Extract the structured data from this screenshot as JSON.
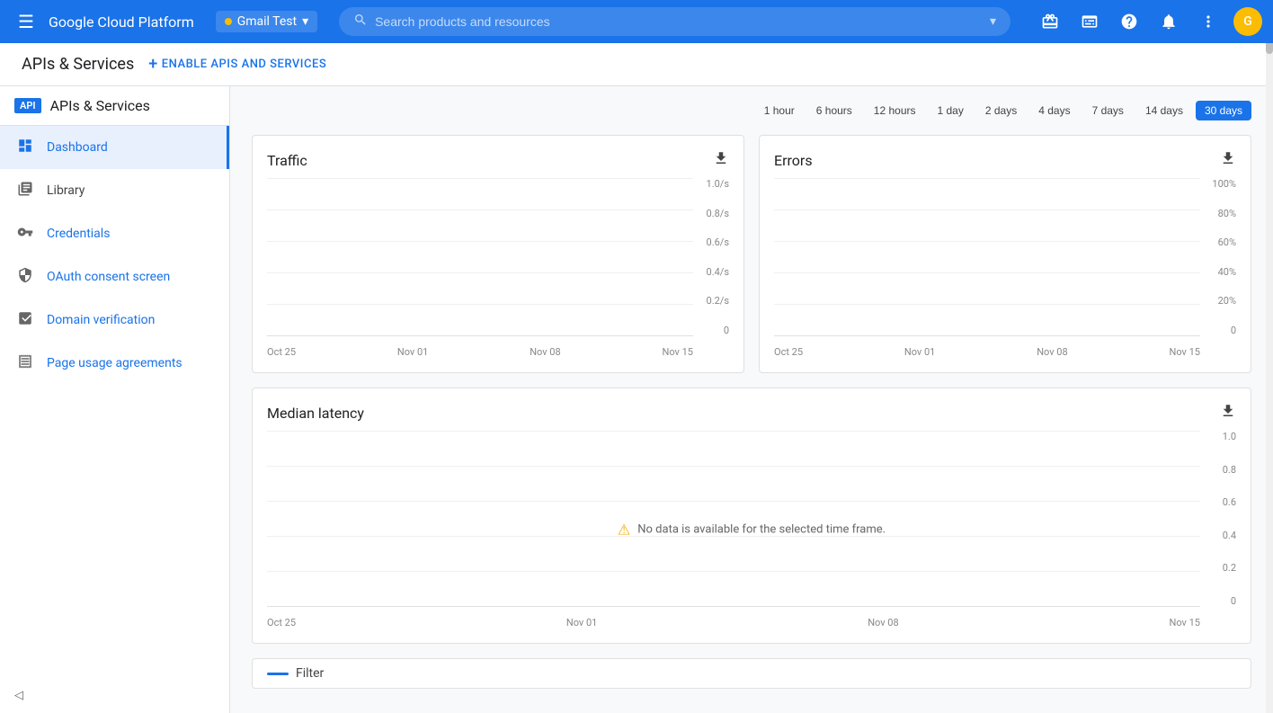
{
  "topNav": {
    "hamburger_icon": "☰",
    "brand": "Google Cloud Platform",
    "project_name": "Gmail Test",
    "project_chevron": "▾",
    "search_placeholder": "Search products and resources",
    "search_chevron": "▾",
    "gift_icon": "🎁",
    "terminal_icon": "▦",
    "help_icon": "?",
    "notification_icon": "🔔",
    "more_icon": "⋮",
    "avatar_text": "G"
  },
  "subHeader": {
    "page_title": "APIs & Services",
    "enable_btn_label": "ENABLE APIS AND SERVICES",
    "plus_icon": "+"
  },
  "sidebar": {
    "api_badge": "API",
    "api_title": "APIs & Services",
    "items": [
      {
        "id": "dashboard",
        "label": "Dashboard",
        "icon": "⊕",
        "active": true
      },
      {
        "id": "library",
        "label": "Library",
        "icon": "▦",
        "active": false
      },
      {
        "id": "credentials",
        "label": "Credentials",
        "icon": "🔑",
        "active": false
      },
      {
        "id": "oauth",
        "label": "OAuth consent screen",
        "icon": "✦",
        "active": false
      },
      {
        "id": "domain",
        "label": "Domain verification",
        "icon": "☑",
        "active": false
      },
      {
        "id": "page-usage",
        "label": "Page usage agreements",
        "icon": "⚙",
        "active": false
      }
    ]
  },
  "timeRange": {
    "buttons": [
      {
        "id": "1h",
        "label": "1 hour",
        "active": false
      },
      {
        "id": "6h",
        "label": "6 hours",
        "active": false
      },
      {
        "id": "12h",
        "label": "12 hours",
        "active": false
      },
      {
        "id": "1d",
        "label": "1 day",
        "active": false
      },
      {
        "id": "2d",
        "label": "2 days",
        "active": false
      },
      {
        "id": "4d",
        "label": "4 days",
        "active": false
      },
      {
        "id": "7d",
        "label": "7 days",
        "active": false
      },
      {
        "id": "14d",
        "label": "14 days",
        "active": false
      },
      {
        "id": "30d",
        "label": "30 days",
        "active": true
      }
    ]
  },
  "trafficChart": {
    "title": "Traffic",
    "download_icon": "⬇",
    "yLabels": [
      "1.0/s",
      "0.8/s",
      "0.6/s",
      "0.4/s",
      "0.2/s",
      "0"
    ],
    "xLabels": [
      "Oct 25",
      "Nov 01",
      "Nov 08",
      "Nov 15"
    ]
  },
  "errorsChart": {
    "title": "Errors",
    "download_icon": "⬇",
    "yLabels": [
      "100%",
      "80%",
      "60%",
      "40%",
      "20%",
      "0"
    ],
    "xLabels": [
      "Oct 25",
      "Nov 01",
      "Nov 08",
      "Nov 15"
    ]
  },
  "medianLatencyChart": {
    "title": "Median latency",
    "download_icon": "⬇",
    "yLabels": [
      "1.0",
      "0.8",
      "0.6",
      "0.4",
      "0.2",
      "0"
    ],
    "xLabels": [
      "Oct 25",
      "Nov 01",
      "Nov 08",
      "Nov 15"
    ],
    "no_data_icon": "⚠",
    "no_data_msg": "No data is available for the selected time frame."
  },
  "filterBar": {
    "label": "Filter"
  }
}
